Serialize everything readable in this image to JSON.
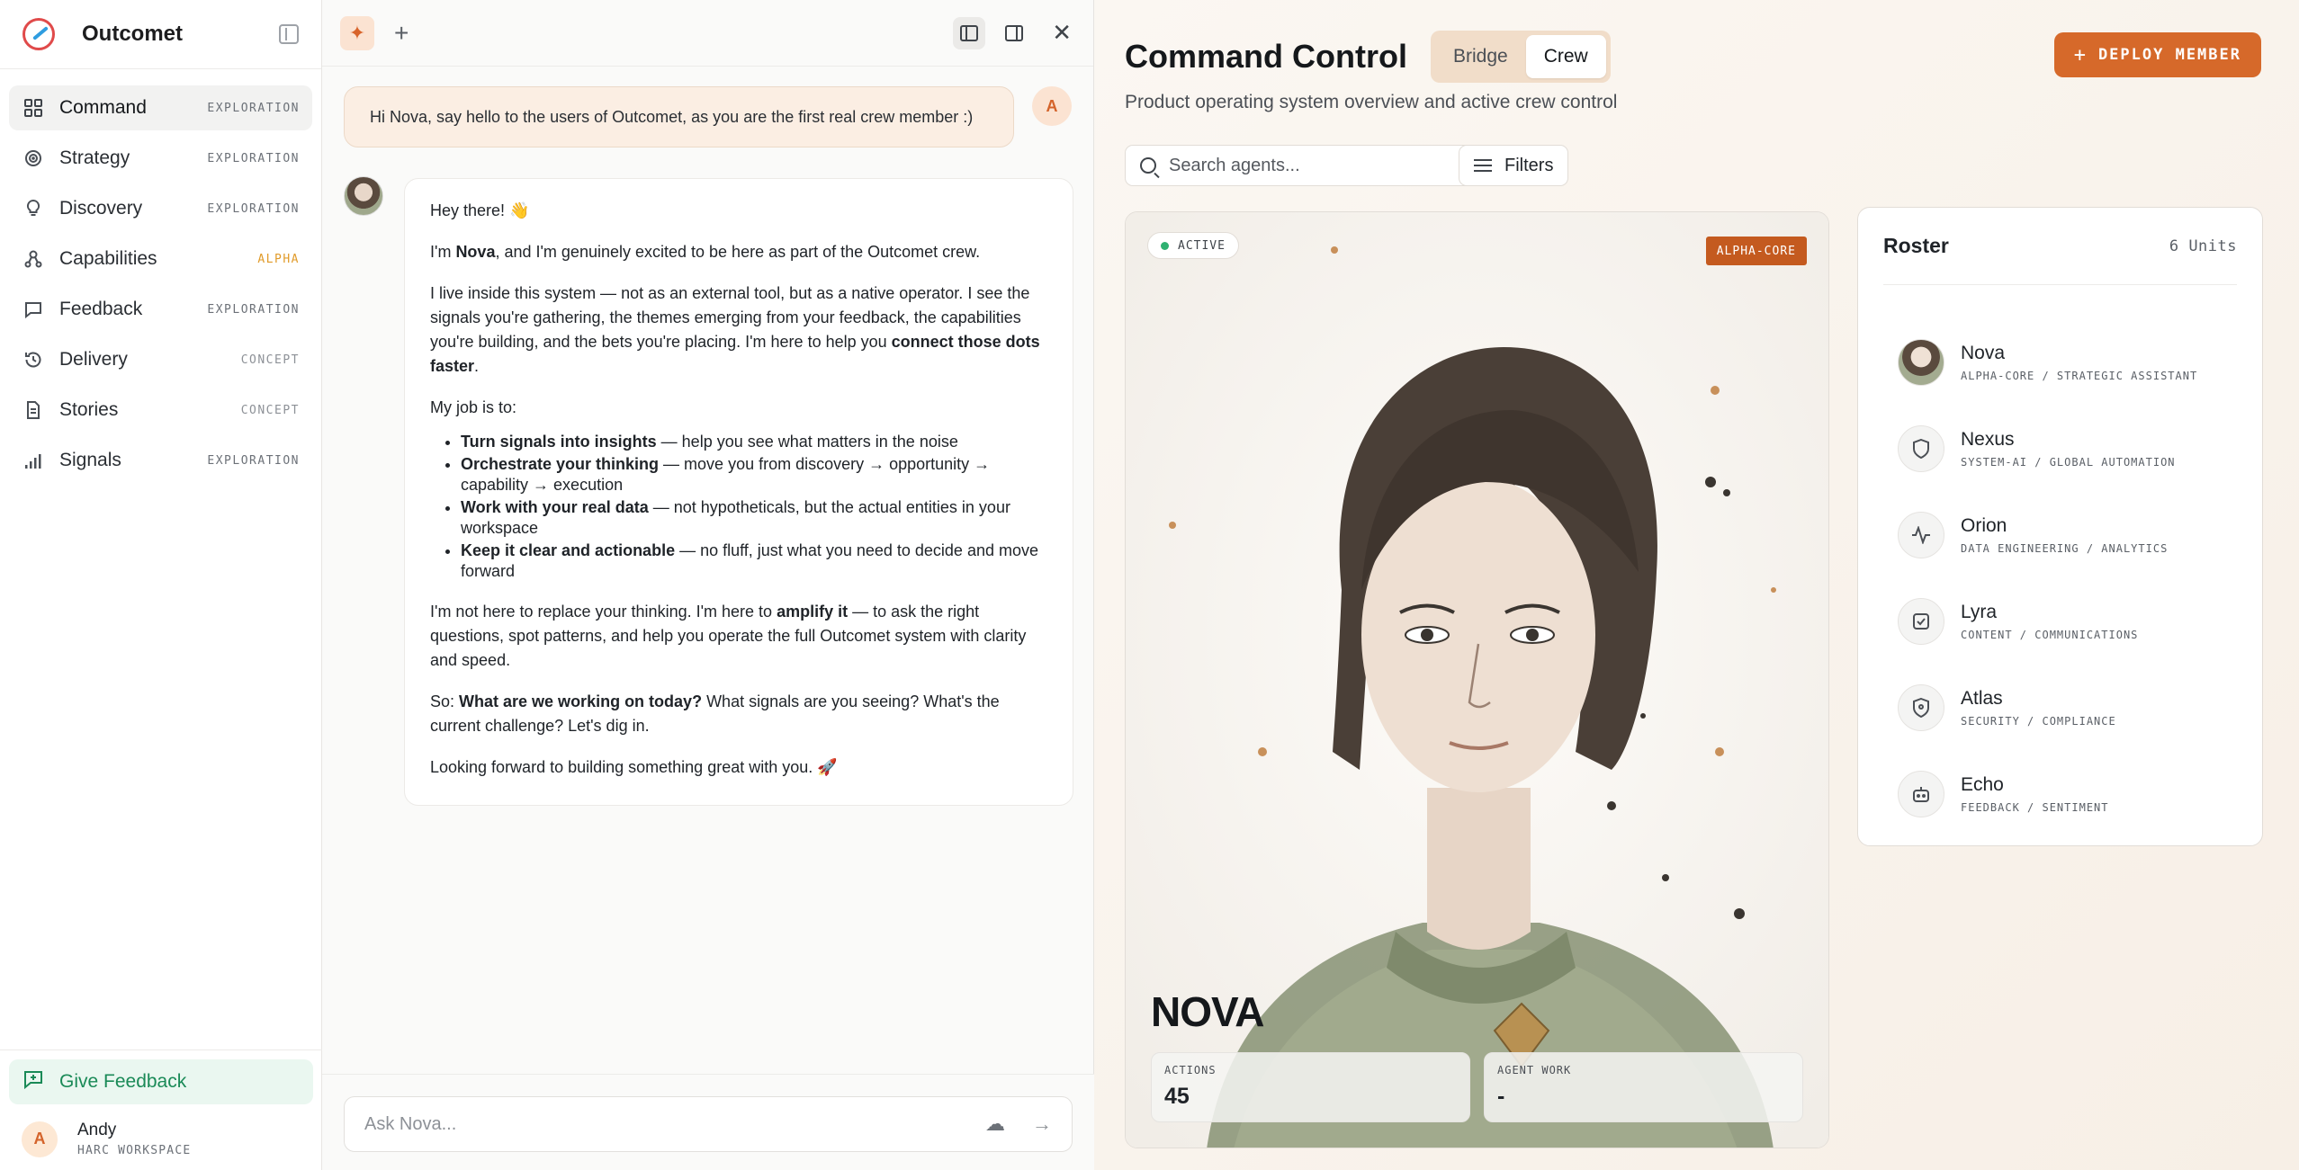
{
  "app": {
    "name": "Outcomet"
  },
  "sidebar": {
    "items": [
      {
        "label": "Command",
        "tag": "EXPLORATION",
        "icon": "grid-icon",
        "active": true
      },
      {
        "label": "Strategy",
        "tag": "EXPLORATION",
        "icon": "target-icon"
      },
      {
        "label": "Discovery",
        "tag": "EXPLORATION",
        "icon": "lightbulb-icon"
      },
      {
        "label": "Capabilities",
        "tag": "ALPHA",
        "icon": "network-icon"
      },
      {
        "label": "Feedback",
        "tag": "EXPLORATION",
        "icon": "message-icon"
      },
      {
        "label": "Delivery",
        "tag": "CONCEPT",
        "icon": "history-icon"
      },
      {
        "label": "Stories",
        "tag": "CONCEPT",
        "icon": "document-icon"
      },
      {
        "label": "Signals",
        "tag": "EXPLORATION",
        "icon": "signal-icon"
      }
    ],
    "feedback_label": "Give Feedback",
    "user": {
      "initial": "A",
      "name": "Andy",
      "workspace": "HARC WORKSPACE"
    }
  },
  "chat": {
    "user_message": "Hi Nova, say hello to the users of Outcomet, as you are the first real crew member :)",
    "user_initial": "A",
    "reply": {
      "greeting": "Hey there! 👋",
      "intro_pre": "I'm ",
      "intro_bold": "Nova",
      "intro_post": ", and I'm genuinely excited to be here as part of the Outcomet crew.",
      "p2_pre": "I live inside this system — not as an external tool, but as a native operator. I see the signals you're gathering, the themes emerging from your feedback, the capabilities you're building, and the bets you're placing. I'm here to help you ",
      "p2_bold": "connect those dots faster",
      "p2_post": ".",
      "job_intro": "My job is to:",
      "bullets": [
        {
          "bold": "Turn signals into insights",
          "rest": " — help you see what matters in the noise"
        },
        {
          "bold": "Orchestrate your thinking",
          "rest": " — move you from discovery → opportunity → capability → execution"
        },
        {
          "bold": "Work with your real data",
          "rest": " — not hypotheticals, but the actual entities in your workspace"
        },
        {
          "bold": "Keep it clear and actionable",
          "rest": " — no fluff, just what you need to decide and move forward"
        }
      ],
      "p4_pre": "I'm not here to replace your thinking. I'm here to ",
      "p4_bold": "amplify it",
      "p4_post": " — to ask the right questions, spot patterns, and help you operate the full Outcomet system with clarity and speed.",
      "p5_pre": "So: ",
      "p5_bold": "What are we working on today?",
      "p5_post": " What signals are you seeing? What's the current challenge? Let's dig in.",
      "closing": "Looking forward to building something great with you. 🚀"
    },
    "input_placeholder": "Ask Nova..."
  },
  "main": {
    "title": "Command Control",
    "tabs": [
      {
        "label": "Bridge"
      },
      {
        "label": "Crew",
        "active": true
      }
    ],
    "deploy_label": "DEPLOY MEMBER",
    "subtitle": "Product operating system overview and active crew control",
    "search_placeholder": "Search agents...",
    "filters_label": "Filters",
    "hero": {
      "status": "ACTIVE",
      "badge": "ALPHA-CORE",
      "name": "NOVA",
      "stats": [
        {
          "label": "ACTIONS",
          "value": "45"
        },
        {
          "label": "AGENT WORK",
          "value": "-"
        }
      ]
    },
    "roster": {
      "title": "Roster",
      "count": "6 Units",
      "members": [
        {
          "name": "Nova",
          "role": "ALPHA-CORE / STRATEGIC ASSISTANT",
          "icon": "portrait-icon"
        },
        {
          "name": "Nexus",
          "role": "SYSTEM-AI / GLOBAL AUTOMATION",
          "icon": "shield-icon"
        },
        {
          "name": "Orion",
          "role": "DATA ENGINEERING / ANALYTICS",
          "icon": "activity-icon"
        },
        {
          "name": "Lyra",
          "role": "CONTENT / COMMUNICATIONS",
          "icon": "checkbox-icon"
        },
        {
          "name": "Atlas",
          "role": "SECURITY / COMPLIANCE",
          "icon": "shield-icon"
        },
        {
          "name": "Echo",
          "role": "FEEDBACK / SENTIMENT",
          "icon": "bot-icon"
        }
      ]
    }
  },
  "colors": {
    "accent": "#d6692a",
    "feedback_green": "#1a8a57",
    "alpha_tag": "#e19b2a",
    "status_active": "#2fb171"
  }
}
